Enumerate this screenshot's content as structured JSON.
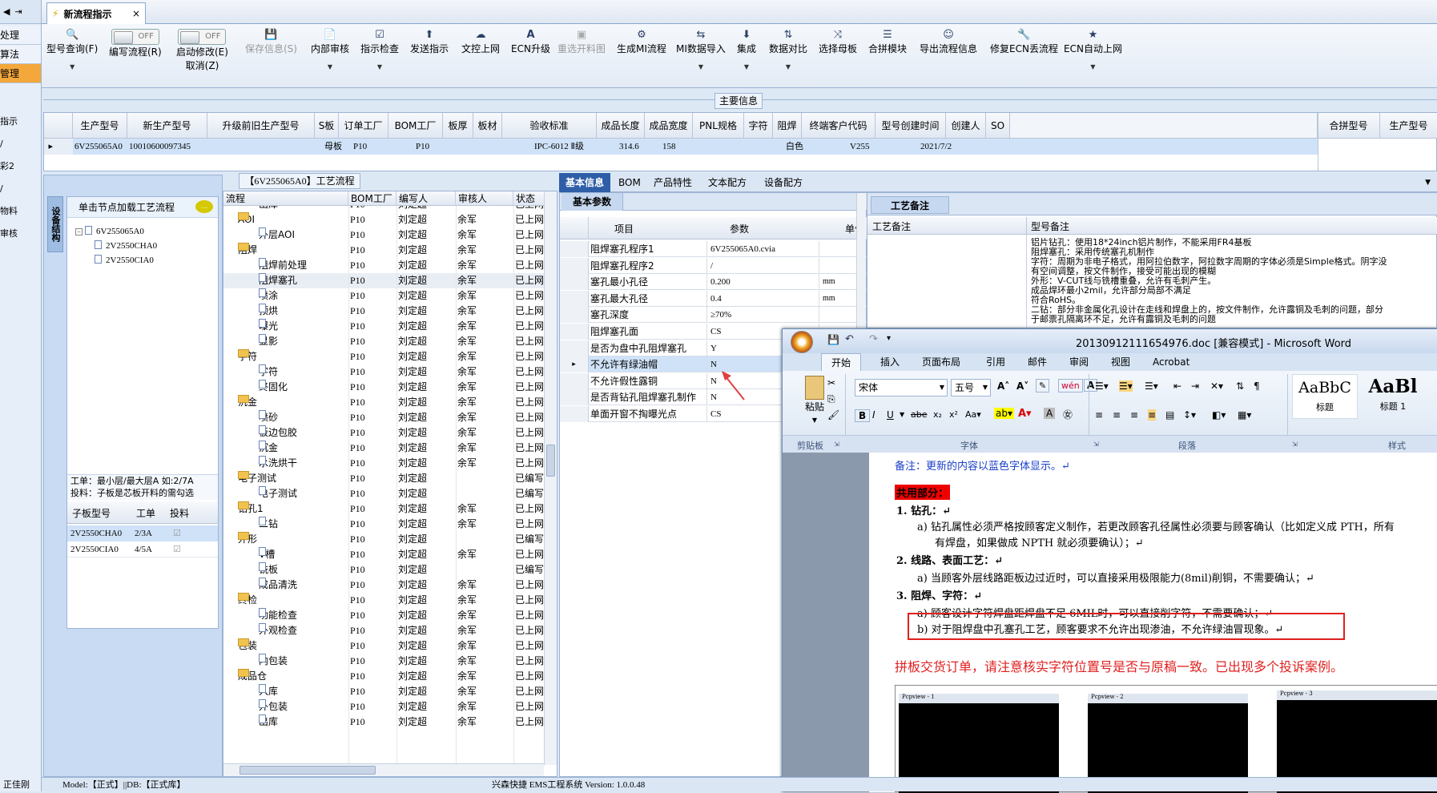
{
  "leftnav": {
    "items": [
      "处理",
      "算法",
      "管理"
    ],
    "items2": [
      "指示",
      "/",
      "彩2",
      "/",
      "物料",
      "审核"
    ]
  },
  "tab": {
    "title": "新流程指示",
    "close": "×"
  },
  "toolbar": {
    "buttons": [
      {
        "label": "型号查询(F)",
        "icon": "🔍"
      },
      {
        "label": "编写流程(R)",
        "switch": "OFF"
      },
      {
        "label": "启动修改(E)",
        "label2": "取消(Z)",
        "switch": "OFF"
      },
      {
        "label": "保存信息(S)",
        "icon": "💾",
        "disabled": true
      },
      {
        "label": "内部审核",
        "icon": "📄"
      },
      {
        "label": "指示检查",
        "icon": "☑"
      },
      {
        "label": "发送指示",
        "icon": "⬆"
      },
      {
        "label": "文控上网",
        "icon": "☁"
      },
      {
        "label": "ECN升级",
        "icon": "A"
      },
      {
        "label": "重选开料图",
        "icon": "▣",
        "disabled": true
      },
      {
        "label": "生成MI流程",
        "icon": "⚙"
      },
      {
        "label": "MI数据导入",
        "icon": "⇆"
      },
      {
        "label": "集成",
        "icon": "⬇"
      },
      {
        "label": "数据对比",
        "icon": "⇅"
      },
      {
        "label": "选择母板",
        "icon": "⤨"
      },
      {
        "label": "合拼模块",
        "icon": "☰"
      },
      {
        "label": "导出流程信息",
        "icon": "☺"
      },
      {
        "label": "修复ECN丢流程",
        "icon": "🔧"
      },
      {
        "label": "ECN自动上网",
        "icon": "★"
      }
    ]
  },
  "main_info": {
    "title": "主要信息",
    "headers": [
      "生产型号",
      "新生产型号",
      "升级前旧生产型号",
      "S板",
      "订单工厂",
      "BOM工厂",
      "板厚",
      "板材",
      "验收标准",
      "成品长度",
      "成品宽度",
      "PNL规格",
      "字符",
      "阻焊",
      "终端客户代码",
      "型号创建时间",
      "创建人",
      "SO"
    ],
    "row": [
      "6V255065A0",
      "10010600097345",
      "",
      "母板",
      "P10",
      "P10",
      "",
      "",
      "IPC-6012 Ⅱ级",
      "314.6",
      "158",
      "",
      "白色",
      "",
      "V255",
      "2021/7/2",
      "",
      ""
    ],
    "side_headers": [
      "合拼型号",
      "生产型号"
    ]
  },
  "process": {
    "title": "【6V255065A0】工艺流程"
  },
  "left": {
    "vtab": "设备结构",
    "prompt": "单击节点加载工艺流程",
    "root": "6V255065A0",
    "children": [
      "2V2550CHA0",
      "2V2550CIA0"
    ],
    "note1": "工单：最小层/最大层A 如:2/7A",
    "note2": "投料：子板是芯板开料的需勾选",
    "sub_headers": [
      "子板型号",
      "工单",
      "投料"
    ],
    "sub_rows": [
      [
        "2V2550CHA0",
        "2/3A",
        "☑"
      ],
      [
        "2V2550CIA0",
        "4/5A",
        "☑"
      ]
    ]
  },
  "tree": {
    "headers": [
      "流程",
      "BOM工厂",
      "编写人",
      "审核人",
      "状态"
    ],
    "rows": [
      {
        "t": "doc",
        "n": "出库",
        "lvl": 2,
        "f": "P10",
        "w": "刘定超",
        "r": "",
        "s": "已上网"
      },
      {
        "t": "fold",
        "n": "AOI",
        "lvl": 1,
        "f": "P10",
        "w": "刘定超",
        "r": "余军",
        "s": "已上网"
      },
      {
        "t": "doc",
        "n": "外层AOI",
        "lvl": 2,
        "f": "P10",
        "w": "刘定超",
        "r": "余军",
        "s": "已上网"
      },
      {
        "t": "fold",
        "n": "阻焊",
        "lvl": 1,
        "f": "P10",
        "w": "刘定超",
        "r": "余军",
        "s": "已上网"
      },
      {
        "t": "doc",
        "n": "阻焊前处理",
        "lvl": 2,
        "f": "P10",
        "w": "刘定超",
        "r": "余军",
        "s": "已上网"
      },
      {
        "t": "doc",
        "n": "阻焊塞孔",
        "lvl": 2,
        "f": "P10",
        "w": "刘定超",
        "r": "余军",
        "s": "已上网"
      },
      {
        "t": "doc",
        "n": "喷涂",
        "lvl": 2,
        "f": "P10",
        "w": "刘定超",
        "r": "余军",
        "s": "已上网"
      },
      {
        "t": "doc",
        "n": "预烘",
        "lvl": 2,
        "f": "P10",
        "w": "刘定超",
        "r": "余军",
        "s": "已上网"
      },
      {
        "t": "doc",
        "n": "曝光",
        "lvl": 2,
        "f": "P10",
        "w": "刘定超",
        "r": "余军",
        "s": "已上网"
      },
      {
        "t": "doc",
        "n": "显影",
        "lvl": 2,
        "f": "P10",
        "w": "刘定超",
        "r": "余军",
        "s": "已上网"
      },
      {
        "t": "fold",
        "n": "字符",
        "lvl": 1,
        "f": "P10",
        "w": "刘定超",
        "r": "余军",
        "s": "已上网"
      },
      {
        "t": "doc",
        "n": "字符",
        "lvl": 2,
        "f": "P10",
        "w": "刘定超",
        "r": "余军",
        "s": "已上网"
      },
      {
        "t": "doc",
        "n": "终固化",
        "lvl": 2,
        "f": "P10",
        "w": "刘定超",
        "r": "余军",
        "s": "已上网"
      },
      {
        "t": "fold",
        "n": "沉金",
        "lvl": 1,
        "f": "P10",
        "w": "刘定超",
        "r": "余军",
        "s": "已上网"
      },
      {
        "t": "doc",
        "n": "喷砂",
        "lvl": 2,
        "f": "P10",
        "w": "刘定超",
        "r": "余军",
        "s": "已上网"
      },
      {
        "t": "doc",
        "n": "板边包胶",
        "lvl": 2,
        "f": "P10",
        "w": "刘定超",
        "r": "余军",
        "s": "已上网"
      },
      {
        "t": "doc",
        "n": "沉金",
        "lvl": 2,
        "f": "P10",
        "w": "刘定超",
        "r": "余军",
        "s": "已上网"
      },
      {
        "t": "doc",
        "n": "水洗烘干",
        "lvl": 2,
        "f": "P10",
        "w": "刘定超",
        "r": "余军",
        "s": "已上网"
      },
      {
        "t": "fold",
        "n": "电子测试",
        "lvl": 1,
        "f": "P10",
        "w": "刘定超",
        "r": "",
        "s": "已编写"
      },
      {
        "t": "doc",
        "n": "电子测试",
        "lvl": 2,
        "f": "P10",
        "w": "刘定超",
        "r": "",
        "s": "已编写"
      },
      {
        "t": "fold",
        "n": "钻孔1",
        "lvl": 1,
        "f": "P10",
        "w": "刘定超",
        "r": "余军",
        "s": "已上网"
      },
      {
        "t": "doc",
        "n": "二钻",
        "lvl": 2,
        "f": "P10",
        "w": "刘定超",
        "r": "余军",
        "s": "已上网"
      },
      {
        "t": "fold",
        "n": "外形",
        "lvl": 1,
        "f": "P10",
        "w": "刘定超",
        "r": "",
        "s": "已编写"
      },
      {
        "t": "doc",
        "n": "V槽",
        "lvl": 2,
        "f": "P10",
        "w": "刘定超",
        "r": "余军",
        "s": "已上网"
      },
      {
        "t": "doc",
        "n": "铣板",
        "lvl": 2,
        "f": "P10",
        "w": "刘定超",
        "r": "",
        "s": "已编写"
      },
      {
        "t": "doc",
        "n": "成品清洗",
        "lvl": 2,
        "f": "P10",
        "w": "刘定超",
        "r": "余军",
        "s": "已上网"
      },
      {
        "t": "fold",
        "n": "终检",
        "lvl": 1,
        "f": "P10",
        "w": "刘定超",
        "r": "余军",
        "s": "已上网"
      },
      {
        "t": "doc",
        "n": "功能检查",
        "lvl": 2,
        "f": "P10",
        "w": "刘定超",
        "r": "余军",
        "s": "已上网"
      },
      {
        "t": "doc",
        "n": "外观检查",
        "lvl": 2,
        "f": "P10",
        "w": "刘定超",
        "r": "余军",
        "s": "已上网"
      },
      {
        "t": "fold",
        "n": "包装",
        "lvl": 1,
        "f": "P10",
        "w": "刘定超",
        "r": "余军",
        "s": "已上网"
      },
      {
        "t": "doc",
        "n": "内包装",
        "lvl": 2,
        "f": "P10",
        "w": "刘定超",
        "r": "余军",
        "s": "已上网"
      },
      {
        "t": "fold",
        "n": "成品仓",
        "lvl": 1,
        "f": "P10",
        "w": "刘定超",
        "r": "余军",
        "s": "已上网"
      },
      {
        "t": "doc",
        "n": "入库",
        "lvl": 2,
        "f": "P10",
        "w": "刘定超",
        "r": "余军",
        "s": "已上网"
      },
      {
        "t": "doc",
        "n": "外包装",
        "lvl": 2,
        "f": "P10",
        "w": "刘定超",
        "r": "余军",
        "s": "已上网"
      },
      {
        "t": "doc",
        "n": "出库",
        "lvl": 2,
        "f": "P10",
        "w": "刘定超",
        "r": "余军",
        "s": "已上网"
      }
    ]
  },
  "rtabs": [
    "基本信息",
    "BOM",
    "产品特性",
    "文本配方",
    "设备配方"
  ],
  "basic": {
    "title": "基本参数",
    "headers": [
      "项目",
      "参数",
      "单位"
    ],
    "rows": [
      [
        "阻焊塞孔程序1",
        "6V255065A0.cvia",
        ""
      ],
      [
        "阻焊塞孔程序2",
        "/",
        ""
      ],
      [
        "塞孔最小孔径",
        "0.200",
        "mm"
      ],
      [
        "塞孔最大孔径",
        "0.4",
        "mm"
      ],
      [
        "塞孔深度",
        "≥70%",
        ""
      ],
      [
        "阻焊塞孔面",
        "CS",
        ""
      ],
      [
        "是否为盘中孔阻焊塞孔",
        "Y",
        ""
      ],
      [
        "不允许有绿油帽",
        "N",
        ""
      ],
      [
        "不允许假性露铜",
        "N",
        ""
      ],
      [
        "是否背钻孔阻焊塞孔制作",
        "N",
        ""
      ],
      [
        "单面开窗不掏曝光点",
        "CS",
        ""
      ]
    ]
  },
  "notes": {
    "title": "工艺备注",
    "headers": [
      "工艺备注",
      "型号备注"
    ],
    "lines": [
      "铝片钻孔：使用18*24inch铝片制作，不能采用FR4基板",
      "阻焊塞孔：采用传统塞孔机制作",
      "字符：周期为非电子格式，用阿拉伯数字，阿拉数字周期的字体必须是Simple格式。阴字没",
      "有空间调整，按文件制作，接受可能出现的模糊",
      "外形：V-CUT线与铣槽重叠，允许有毛刺产生。",
      "成品焊环最小2mil，允许部分局部不满足",
      "符合RoHS。",
      "二钻：部分非金属化孔设计在走线和焊盘上的，按文件制作，允许露铜及毛刺的问题，部分",
      "于邮票孔隔离环不足，允许有露铜及毛刺的问题"
    ]
  },
  "word": {
    "title": "20130912111654976.doc [兼容模式] - Microsoft Word",
    "tabs": [
      "开始",
      "插入",
      "页面布局",
      "引用",
      "邮件",
      "审阅",
      "视图",
      "Acrobat"
    ],
    "font": "宋体",
    "size": "五号",
    "groups": [
      "剪贴板",
      "字体",
      "段落",
      "样式"
    ],
    "paste": "粘贴",
    "styles": [
      {
        "preview": "AaBbC",
        "name": "标题"
      },
      {
        "preview": "AaBl",
        "name": "标题 1"
      }
    ],
    "doc": {
      "note": "备注：更新的内容以蓝色字体显示。↵",
      "common": "共用部分：",
      "s1": "1.  钻孔：↵",
      "s1a": "a)  钻孔属性必须严格按顾客定义制作，若更改顾客孔径属性必须要与顾客确认（比如定义成 PTH，所有",
      "s1a2": "有焊盘，如果做成 NPTH 就必须要确认）；↵",
      "s2": "2.  线路、表面工艺：↵",
      "s2a": "a)  当顾客外层线路距板边过近时，可以直接采用极限能力(8mil)削铜，不需要确认；↵",
      "s3": "3.  阻焊、字符：↵",
      "s3a": "a)  顾客设计字符焊盘距焊盘不足 6MIL时，可以直接削字符，不需要确认；↵",
      "s3b": "b)  对于阻焊盘中孔塞孔工艺，顾客要求不允许出现渗油，不允许绿油冒现象。↵",
      "red": "拼板交货订单，请注意核实字符位置号是否与原稿一致。已出现多个投诉案例。",
      "thumbs": [
        "Pcpview - 1",
        "Pcpview - 2",
        "Pcpview - 3"
      ]
    }
  },
  "status": {
    "left": "正佳刚",
    "model": "Model:【正式】||DB:【正式库】",
    "system": "兴森快捷 EMS工程系统 Version: 1.0.0.48"
  }
}
